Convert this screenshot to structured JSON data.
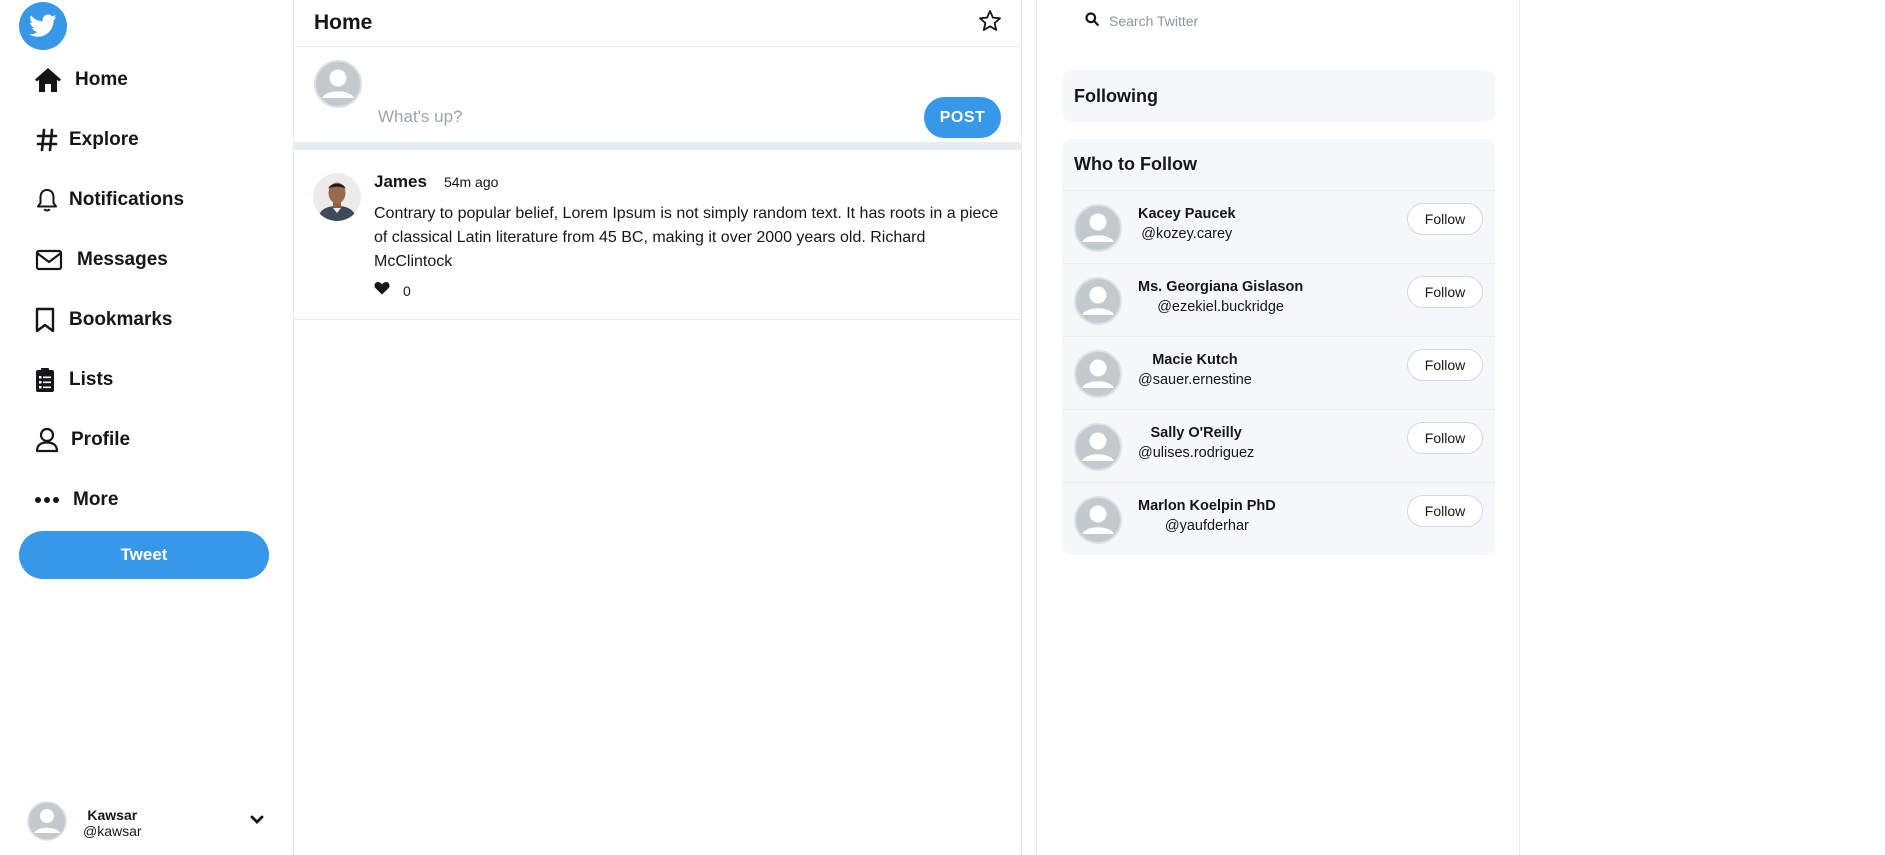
{
  "colors": {
    "accent": "#3797e8",
    "border": "#e6ecf0",
    "panel_bg": "#f5f8fa",
    "avatar_gray": "#c4c9ce"
  },
  "sidebar": {
    "logo_icon": "twitter-bird-icon",
    "nav": [
      {
        "label": "Home",
        "icon": "home-icon"
      },
      {
        "label": "Explore",
        "icon": "hashtag-icon"
      },
      {
        "label": "Notifications",
        "icon": "bell-icon"
      },
      {
        "label": "Messages",
        "icon": "mail-icon"
      },
      {
        "label": "Bookmarks",
        "icon": "bookmark-icon"
      },
      {
        "label": "Lists",
        "icon": "clipboard-list-icon"
      },
      {
        "label": "Profile",
        "icon": "user-icon"
      },
      {
        "label": "More",
        "icon": "more-dots-icon"
      }
    ],
    "tweet_button": "Tweet",
    "account": {
      "name": "Kawsar",
      "handle": "@kawsar"
    }
  },
  "feed": {
    "title": "Home",
    "compose": {
      "placeholder": "What's up?",
      "post_button": "POST"
    },
    "posts": [
      {
        "author": "James",
        "time": "54m ago",
        "text": "Contrary to popular belief, Lorem Ipsum is not simply random text. It has roots in a piece of classical Latin literature from 45 BC, making it over 2000 years old. Richard McClintock",
        "likes": "0"
      }
    ]
  },
  "right": {
    "search": {
      "placeholder": "Search Twitter"
    },
    "following_title": "Following",
    "who_title": "Who to Follow",
    "follow_label": "Follow",
    "suggestions": [
      {
        "name": "Kacey Paucek",
        "handle": "@kozey.carey"
      },
      {
        "name": "Ms. Georgiana Gislason",
        "handle": "@ezekiel.buckridge"
      },
      {
        "name": "Macie Kutch",
        "handle": "@sauer.ernestine"
      },
      {
        "name": "Sally O'Reilly",
        "handle": "@ulises.rodriguez"
      },
      {
        "name": "Marlon Koelpin PhD",
        "handle": "@yaufderhar"
      }
    ]
  }
}
